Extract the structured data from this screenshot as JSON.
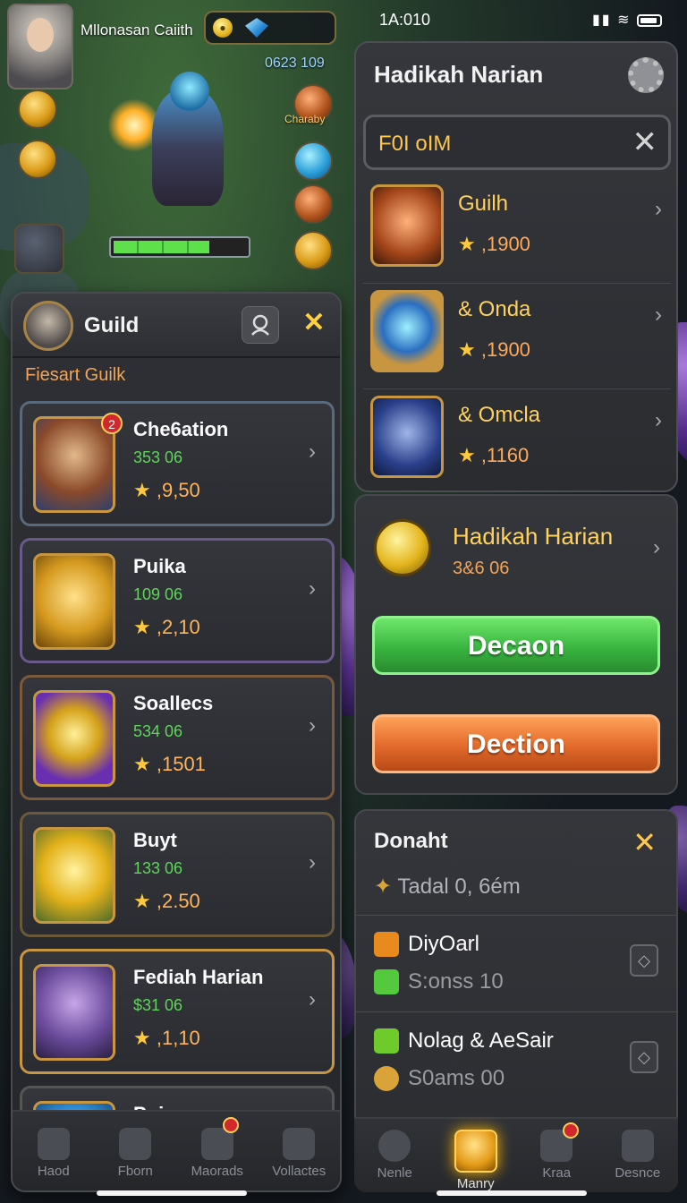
{
  "hud": {
    "player_name": "Mllonasan Caiith",
    "score": "0623 109",
    "chest_label": "Charaby"
  },
  "guild_panel": {
    "title": "Guild",
    "subtitle": "Fiesart Guilk",
    "items": [
      {
        "name": "Che6ation",
        "code": "353 06",
        "score": "9,50",
        "badge": "2",
        "theme": "hero"
      },
      {
        "name": "Puika",
        "code": "109 06",
        "score": "2,10",
        "theme": "shield"
      },
      {
        "name": "Soallecs",
        "code": "534 06",
        "score": "1501",
        "theme": "magic"
      },
      {
        "name": "Buyt",
        "code": "133 06",
        "score": "2.50",
        "theme": "gold"
      },
      {
        "name": "Fediah Harian",
        "code": "$31 06",
        "score": "1,10",
        "theme": "hero2"
      },
      {
        "name": "Puin",
        "code": "",
        "score": "",
        "theme": "blue"
      }
    ],
    "nav": [
      {
        "label": "Haod",
        "icon": "home-icon"
      },
      {
        "label": "Fborn",
        "icon": "search-icon"
      },
      {
        "label": "Maorads",
        "icon": "compass-icon",
        "badge": true
      },
      {
        "label": "Vollactes",
        "icon": "camera-icon"
      }
    ]
  },
  "status_bar": {
    "time": "1A:010"
  },
  "right_panel": {
    "title": "Hadikah Narian",
    "search_query": "F0I oIM",
    "items": [
      {
        "name": "Guilh",
        "score": "1900",
        "theme": "copper"
      },
      {
        "name": "& Onda",
        "score": "1900",
        "theme": "card"
      },
      {
        "name": "& Omcla",
        "score": "1160",
        "theme": "crystal"
      }
    ],
    "reward": {
      "name": "Hadikah Harian",
      "sub": "3&6 06",
      "primary_button": "Decaon",
      "secondary_button": "Dection"
    },
    "donate": {
      "title": "Donaht",
      "total": "Tadal 0, 6ém",
      "rows": [
        {
          "title": "DiyOarl",
          "sub": "S:onss 10",
          "color1": "#e88a1e",
          "color2": "#54c93e"
        },
        {
          "title": "Nolag & AeSair",
          "sub": "S0ams 00",
          "color1": "#6fca2c",
          "color2": "#d9a33a"
        }
      ]
    },
    "nav": [
      {
        "label": "Nenle",
        "icon": "bomb-icon"
      },
      {
        "label": "Manry",
        "icon": "shield-emblem-icon",
        "active": true
      },
      {
        "label": "Kraa",
        "icon": "map-icon",
        "badge": true
      },
      {
        "label": "Desnce",
        "icon": "menu-icon"
      }
    ]
  }
}
